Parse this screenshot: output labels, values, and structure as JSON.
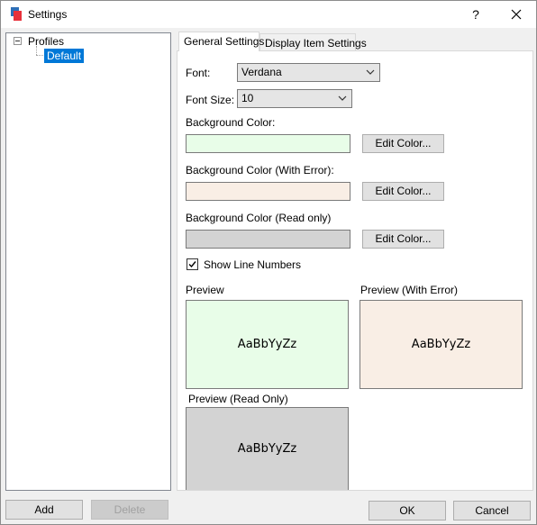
{
  "window": {
    "title": "Settings",
    "help_label": "?"
  },
  "tree": {
    "root": "Profiles",
    "children": [
      "Default"
    ]
  },
  "tabs": [
    {
      "label": "General Settings",
      "active": true
    },
    {
      "label": "Display Item Settings",
      "active": false
    }
  ],
  "general": {
    "font_label": "Font:",
    "font_value": "Verdana",
    "font_size_label": "Font Size:",
    "font_size_value": "10",
    "bg_label": "Background Color:",
    "bg_color": "#e8fde8",
    "bg_error_label": "Background Color (With Error):",
    "bg_error_color": "#f9eee5",
    "bg_readonly_label": "Background Color (Read only)",
    "bg_readonly_color": "#d3d3d3",
    "edit_color_label": "Edit Color...",
    "show_line_numbers_label": "Show Line Numbers",
    "show_line_numbers_checked": true,
    "preview_label": "Preview",
    "preview_error_label": "Preview (With Error)",
    "preview_readonly_label": "Preview (Read Only)",
    "preview_text": "AaBbYyZz"
  },
  "footer": {
    "add_label": "Add",
    "delete_label": "Delete",
    "ok_label": "OK",
    "cancel_label": "Cancel"
  }
}
